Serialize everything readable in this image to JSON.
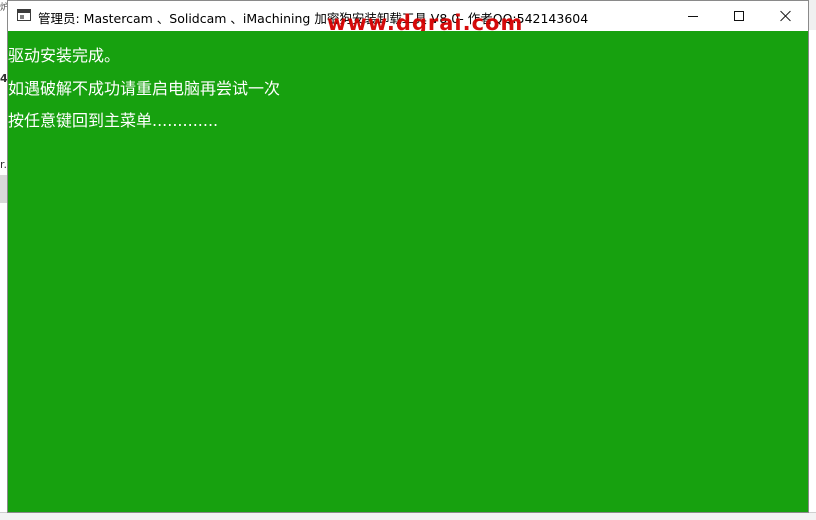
{
  "background": {
    "glyph_1": "炉",
    "glyph_2": "4",
    "glyph_3": "r.e"
  },
  "window": {
    "title": "管理员:  Mastercam 、Solidcam  、iMachining 加密狗安装卸载工具 V8.0- 作者QQ:542143604",
    "watermark": "www.dgrai.com",
    "buttons": {
      "minimize": "minimize",
      "maximize": "maximize",
      "close": "close"
    }
  },
  "console": {
    "lines": [
      "驱动安装完成。",
      "如遇破解不成功请重启电脑再尝试一次",
      "按任意键回到主菜单............."
    ]
  },
  "colors": {
    "console_background": "#17a10f",
    "console_text": "#ffffff",
    "watermark": "#d40000"
  }
}
